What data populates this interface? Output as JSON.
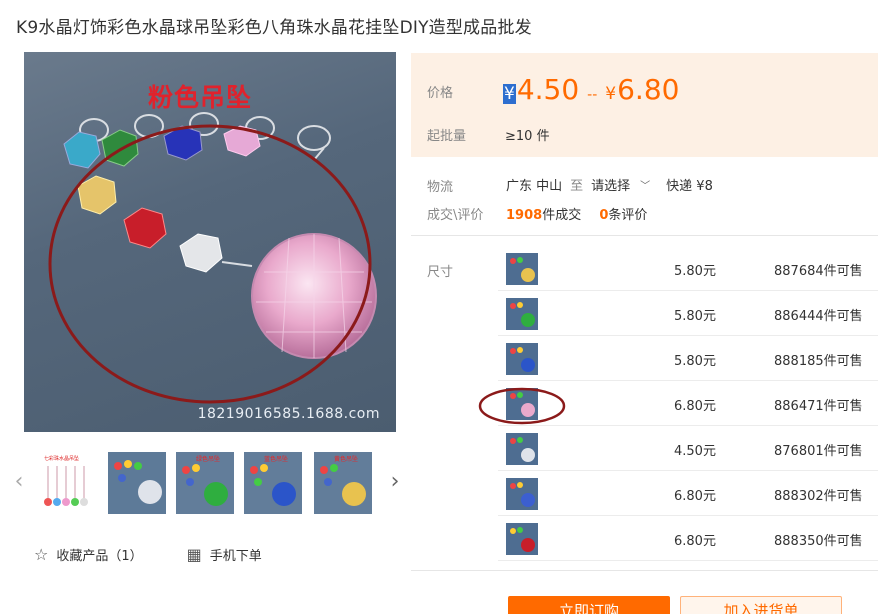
{
  "product": {
    "title": "K9水晶灯饰彩色水晶球吊坠彩色八角珠水晶花挂坠DIY造型成品批发",
    "image_title": "粉色吊坠",
    "image_watermark": "18219016585.1688.com"
  },
  "actions": {
    "favorite": "收藏产品（1）",
    "mobile_order": "手机下单"
  },
  "price": {
    "label": "价格",
    "currency": "¥",
    "low": "4.50",
    "separator": "--",
    "high": "6.80",
    "min_qty_label": "起批量",
    "min_qty": "≥10 件"
  },
  "logistics": {
    "label": "物流",
    "origin": "广东 中山",
    "to": "至",
    "destination": "请选择",
    "express": "快递 ¥8"
  },
  "trade": {
    "label": "成交\\评价",
    "deals": "1908",
    "deals_suffix": "件成交",
    "reviews": "0",
    "reviews_suffix": "条评价"
  },
  "sku": {
    "label": "尺寸",
    "rows": [
      {
        "price": "5.80元",
        "stock": "887684件可售"
      },
      {
        "price": "5.80元",
        "stock": "886444件可售"
      },
      {
        "price": "5.80元",
        "stock": "888185件可售"
      },
      {
        "price": "6.80元",
        "stock": "886471件可售"
      },
      {
        "price": "4.50元",
        "stock": "876801件可售"
      },
      {
        "price": "6.80元",
        "stock": "888302件可售"
      },
      {
        "price": "6.80元",
        "stock": "888350件可售"
      }
    ]
  },
  "buttons": {
    "buy": "立即订购",
    "cart": "加入进货单"
  },
  "colors": {
    "accent": "#ff6a00",
    "price_bg": "#fdf0e4",
    "annotation": "#8b1a1a"
  }
}
